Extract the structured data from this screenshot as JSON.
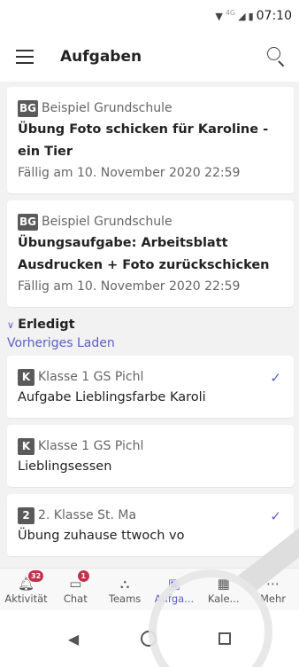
{
  "status_bar": {
    "network": "4G",
    "time": "07:10"
  },
  "header": {
    "title": "Aufgaben"
  },
  "assignments_upcoming": [
    {
      "badge": "BG",
      "class_name": "Beispiel Grundschule",
      "title": "Übung Foto schicken für Karoline - ein Tier",
      "due": "Fällig am 10. November 2020 22:59"
    },
    {
      "badge": "BG",
      "class_name": "Beispiel Grundschule",
      "title": "Übungsaufgabe: Arbeitsblatt Ausdrucken + Foto zurückschicken",
      "due": "Fällig am 10. November 2020 22:59"
    }
  ],
  "done_section": {
    "label": "Erledigt",
    "load_previous": "Vorheriges Laden"
  },
  "assignments_done": [
    {
      "badge": "K",
      "class_name": "Klasse 1 GS Pichl",
      "title": "Aufgabe Lieblingsfarbe Karoli",
      "checked": true
    },
    {
      "badge": "K",
      "class_name": "Klasse 1 GS Pichl",
      "title": "Lieblingsessen",
      "checked": false
    },
    {
      "badge": "2",
      "class_name": "2. Klasse St. Ma",
      "title": "Übung zuhause  ttwoch vo",
      "checked": true
    }
  ],
  "bottom_nav": [
    {
      "label": "Aktivität",
      "icon": "bell-icon",
      "count": "32",
      "active": false
    },
    {
      "label": "Chat",
      "icon": "chat-icon",
      "count": "1",
      "active": false
    },
    {
      "label": "Teams",
      "icon": "teams-icon",
      "count": "",
      "active": false
    },
    {
      "label": "Aufga...",
      "icon": "assignments-icon",
      "count": "",
      "active": true
    },
    {
      "label": "Kale...",
      "icon": "calendar-icon",
      "count": "",
      "active": false
    },
    {
      "label": "Mehr",
      "icon": "more-icon",
      "count": "",
      "active": false
    }
  ],
  "colors": {
    "accent": "#5b5fc7",
    "badge_red": "#c4314b",
    "badge_gray": "#5a5a5a"
  }
}
